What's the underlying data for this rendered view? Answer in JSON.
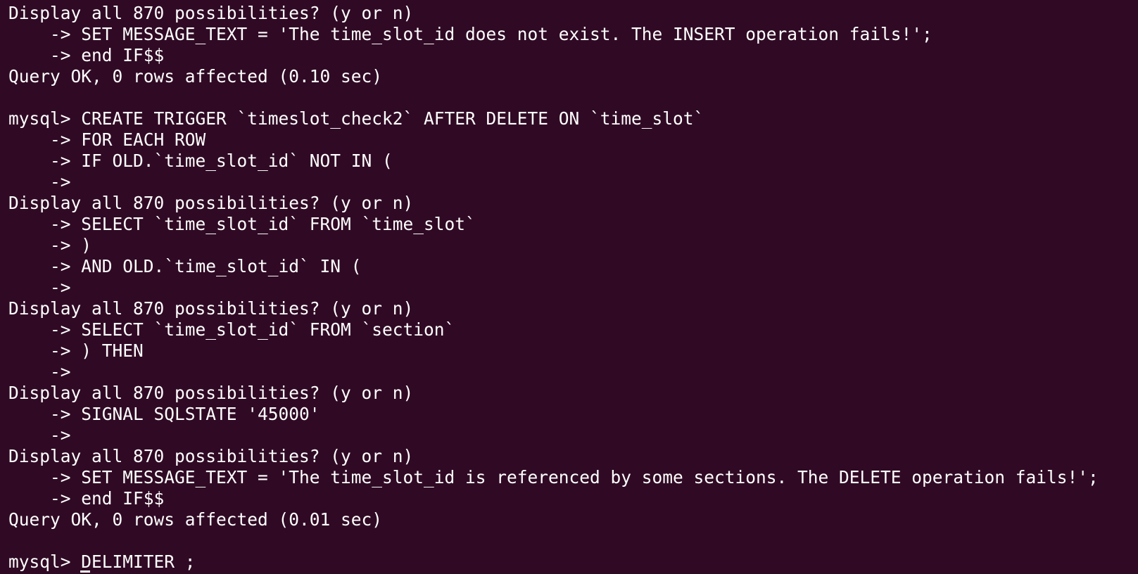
{
  "terminal": {
    "lines": [
      "Display all 870 possibilities? (y or n)",
      "    -> SET MESSAGE_TEXT = 'The time_slot_id does not exist. The INSERT operation fails!';",
      "    -> end IF$$",
      "Query OK, 0 rows affected (0.10 sec)",
      "",
      "mysql> CREATE TRIGGER `timeslot_check2` AFTER DELETE ON `time_slot`",
      "    -> FOR EACH ROW",
      "    -> IF OLD.`time_slot_id` NOT IN (",
      "    ->",
      "Display all 870 possibilities? (y or n)",
      "    -> SELECT `time_slot_id` FROM `time_slot`",
      "    -> )",
      "    -> AND OLD.`time_slot_id` IN (",
      "    ->",
      "Display all 870 possibilities? (y or n)",
      "    -> SELECT `time_slot_id` FROM `section`",
      "    -> ) THEN",
      "    ->",
      "Display all 870 possibilities? (y or n)",
      "    -> SIGNAL SQLSTATE '45000'",
      "    ->",
      "Display all 870 possibilities? (y or n)",
      "    -> SET MESSAGE_TEXT = 'The time_slot_id is referenced by some sections. The DELETE operation fails!';",
      "    -> end IF$$",
      "Query OK, 0 rows affected (0.01 sec)",
      "",
      "mysql> DELIMITER ;"
    ]
  }
}
